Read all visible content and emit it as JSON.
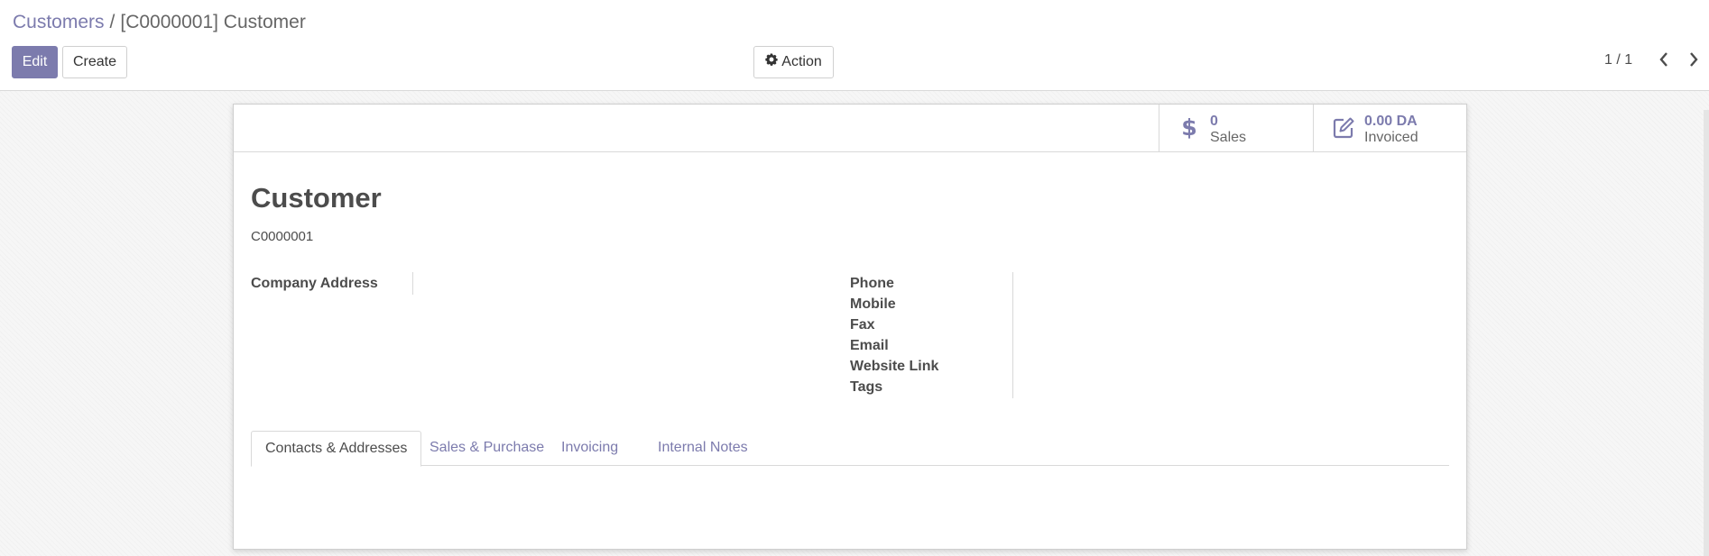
{
  "breadcrumb": {
    "parent": "Customers",
    "separator": "/",
    "current": "[C0000001] Customer"
  },
  "toolbar": {
    "edit_label": "Edit",
    "create_label": "Create",
    "action_label": "Action",
    "action_icon": "gear-icon"
  },
  "pager": {
    "value": "1 / 1",
    "prev_icon": "chevron-left-icon",
    "next_icon": "chevron-right-icon"
  },
  "stat_buttons": [
    {
      "value": "0",
      "label": "Sales",
      "icon": "dollar-icon"
    },
    {
      "value": "0.00 DA",
      "label": "Invoiced",
      "icon": "edit-icon"
    }
  ],
  "record": {
    "name": "Customer",
    "ref": "C0000001"
  },
  "fields": {
    "company_address_label": "Company Address",
    "right": [
      "Phone",
      "Mobile",
      "Fax",
      "Email",
      "Website Link",
      "Tags"
    ]
  },
  "tabs": [
    {
      "label": "Contacts & Addresses",
      "active": true
    },
    {
      "label": "Sales & Purchase",
      "active": false
    },
    {
      "label": "Invoicing",
      "active": false
    },
    {
      "label": "Internal Notes",
      "active": false
    }
  ],
  "colors": {
    "primary": "#7c7bad",
    "text": "#4c4c4c",
    "border": "#d9d9d9",
    "background": "#f6f6f6"
  }
}
